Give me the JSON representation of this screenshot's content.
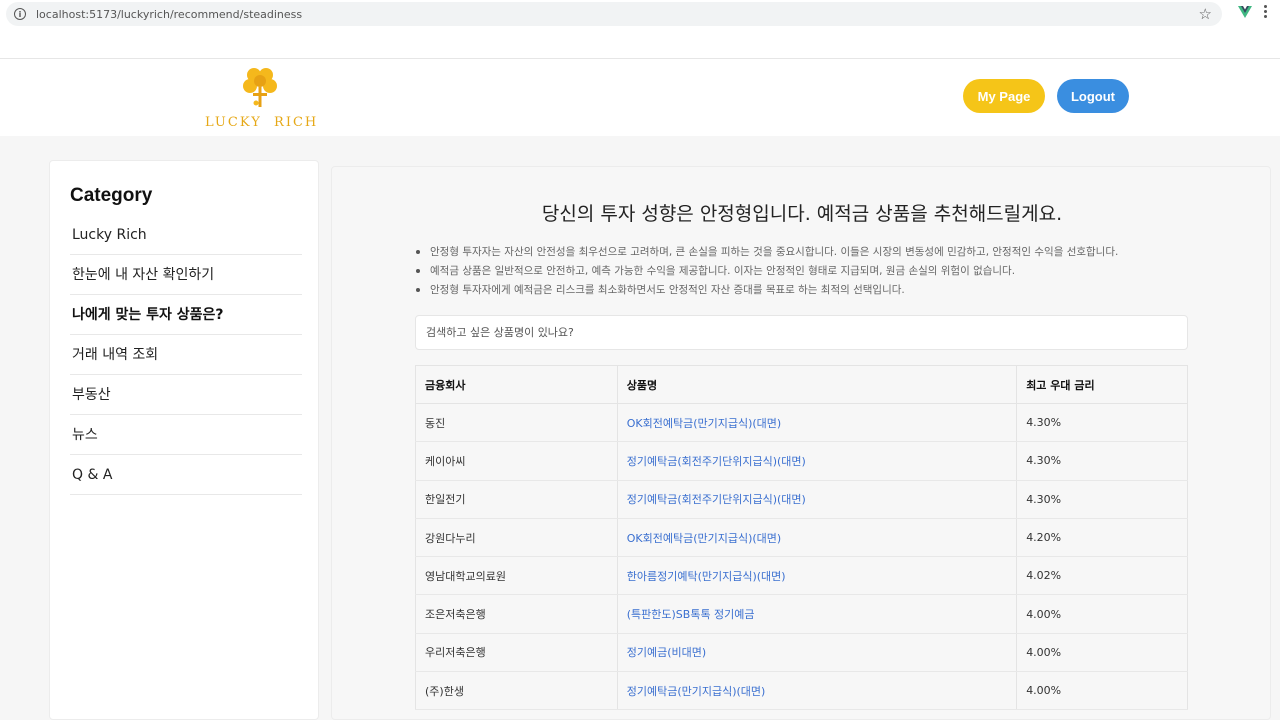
{
  "browser": {
    "url": "localhost:5173/luckyrich/recommend/steadiness"
  },
  "header": {
    "logo_text": "LUCKY  RICH",
    "mypage_label": "My Page",
    "logout_label": "Logout"
  },
  "sidebar": {
    "title": "Category",
    "items": [
      {
        "label": "Lucky Rich"
      },
      {
        "label": "한눈에 내 자산 확인하기"
      },
      {
        "label": "나에게 맞는 투자 상품은?"
      },
      {
        "label": "거래 내역 조회"
      },
      {
        "label": "부동산"
      },
      {
        "label": "뉴스"
      },
      {
        "label": "Q & A"
      }
    ]
  },
  "main": {
    "title": "당신의 투자 성향은 안정형입니다. 예적금 상품을 추천해드릴게요.",
    "descriptions": [
      "안정형 투자자는 자산의 안전성을 최우선으로 고려하며, 큰 손실을 피하는 것을 중요시합니다. 이들은 시장의 변동성에 민감하고, 안정적인 수익을 선호합니다.",
      "예적금 상품은 일반적으로 안전하고, 예측 가능한 수익을 제공합니다. 이자는 안정적인 형태로 지급되며, 원금 손실의 위험이 없습니다.",
      "안정형 투자자에게 예적금은 리스크를 최소화하면서도 안정적인 자산 증대를 목표로 하는 최적의 선택입니다."
    ],
    "search_placeholder": "검색하고 싶은 상품명이 있나요?",
    "table": {
      "headers": [
        "금융회사",
        "상품명",
        "최고 우대 금리"
      ],
      "rows": [
        [
          "동진",
          "OK회전예탁금(만기지급식)(대면)",
          "4.30%"
        ],
        [
          "케이아씨",
          "정기예탁금(회전주기단위지급식)(대면)",
          "4.30%"
        ],
        [
          "한일전기",
          "정기예탁금(회전주기단위지급식)(대면)",
          "4.30%"
        ],
        [
          "강원다누리",
          "OK회전예탁금(만기지급식)(대면)",
          "4.20%"
        ],
        [
          "영남대학교의료원",
          "한아름정기예탁(만기지급식)(대면)",
          "4.02%"
        ],
        [
          "조은저축은행",
          "(특판한도)SB톡톡 정기예금",
          "4.00%"
        ],
        [
          "우리저축은행",
          "정기예금(비대면)",
          "4.00%"
        ],
        [
          "(주)한생",
          "정기예탁금(만기지급식)(대면)",
          "4.00%"
        ]
      ]
    }
  }
}
